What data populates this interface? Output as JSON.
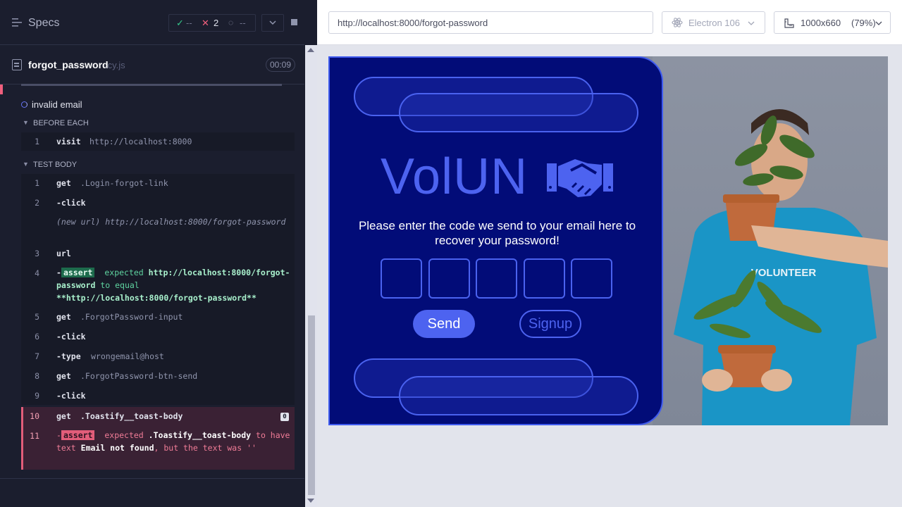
{
  "runner": {
    "specs_label": "Specs",
    "stats": {
      "passed": "--",
      "failed": "2",
      "pending": "--"
    },
    "file": {
      "name": "forgot_password",
      "ext": ".cy.js",
      "duration": "00:09"
    },
    "test_title": "invalid email",
    "before_each_label": "BEFORE EACH",
    "test_body_label": "TEST BODY",
    "before_each": [
      {
        "num": "1",
        "name": "visit",
        "message": "http://localhost:8000"
      }
    ],
    "commands": [
      {
        "num": "1",
        "name": "get",
        "message": ".Login-forgot-link"
      },
      {
        "num": "2",
        "name": "-click",
        "message": ""
      },
      {
        "num": "",
        "name": "",
        "message": "(new url)  http://localhost:8000/forgot-password"
      },
      {
        "num": "3",
        "name": "url",
        "message": ""
      },
      {
        "num": "4",
        "name": "-",
        "badge": "assert",
        "message_prefix": "expected",
        "value1": "http://localhost:8000/forgot-password",
        "connector": "to equal",
        "value2": "**http://localhost:8000/forgot-password**"
      },
      {
        "num": "5",
        "name": "get",
        "message": ".ForgotPassword-input"
      },
      {
        "num": "6",
        "name": "-click",
        "message": ""
      },
      {
        "num": "7",
        "name": "-type",
        "message": "wrongemail@host"
      },
      {
        "num": "8",
        "name": "get",
        "message": ".ForgotPassword-btn-send"
      },
      {
        "num": "9",
        "name": "-click",
        "message": ""
      },
      {
        "num": "10",
        "name": "get",
        "message": ".Toastify__toast-body",
        "count": "0"
      },
      {
        "num": "11",
        "name": "-",
        "badge": "assert",
        "message_prefix": "expected",
        "value1": ".Toastify__toast-body",
        "connector1": "to have text",
        "value2": "Email not found",
        "connector2": ", but the text was",
        "tail": "''"
      }
    ]
  },
  "browser": {
    "url": "http://localhost:8000/forgot-password",
    "browser_name": "Electron 106",
    "viewport": "1000x660",
    "scale": "(79%)"
  },
  "app": {
    "logo": "VolUN",
    "prompt": "Please enter the code we send to your email here to recover your password!",
    "send_label": "Send",
    "signup_label": "Signup",
    "shirt_text": "VOLUNTEER",
    "colors": {
      "card": "#020c78",
      "accent": "#4d63f0",
      "shirt": "#1596c4"
    }
  }
}
